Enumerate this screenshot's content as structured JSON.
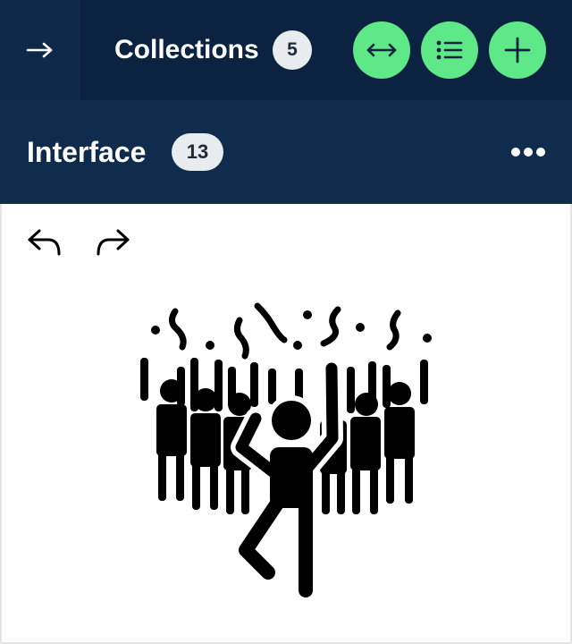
{
  "header": {
    "collections_label": "Collections",
    "collections_count": "5"
  },
  "subheader": {
    "title": "Interface",
    "count": "13"
  },
  "icons": {
    "collapse": "arrow-right-icon",
    "expand": "horizontal-arrows-icon",
    "list": "list-icon",
    "add": "plus-icon",
    "more": "more-dots-icon",
    "undo": "undo-icon",
    "redo": "redo-icon",
    "illustration": "celebration-crowd-icon"
  },
  "colors": {
    "header_bg": "#0b2340",
    "accent_green": "#5fe887",
    "badge_bg": "#e9ecef"
  }
}
